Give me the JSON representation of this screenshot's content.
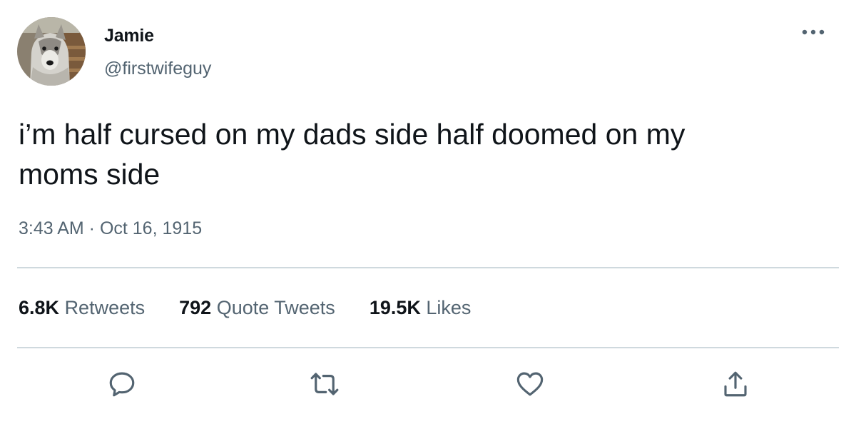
{
  "user": {
    "name": "Jamie",
    "handle": "@firstwifeguy",
    "avatar_icon": "dog-avatar"
  },
  "tweet": {
    "text": "i’m half cursed on my dads side half doomed on my\nmoms side",
    "timestamp": "3:43 AM · Oct 16, 1915"
  },
  "stats": {
    "retweets_count": "6.8K",
    "retweets_label": "Retweets",
    "quotes_count": "792",
    "quotes_label": "Quote Tweets",
    "likes_count": "19.5K",
    "likes_label": "Likes"
  },
  "actions": {
    "reply_icon": "reply-icon",
    "retweet_icon": "retweet-icon",
    "like_icon": "heart-icon",
    "share_icon": "share-icon",
    "more_icon": "more-icon"
  },
  "colors": {
    "text": "#0f1419",
    "secondary": "#536471",
    "divider": "#cfd9de",
    "icon": "#536471"
  }
}
